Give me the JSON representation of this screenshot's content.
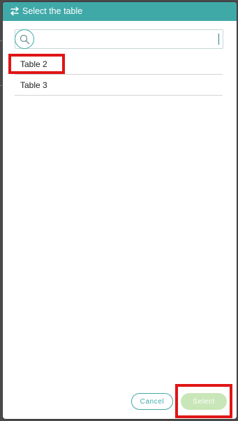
{
  "dialog": {
    "title": "Select the table",
    "header_icon": "swap-arrows-icon",
    "header_color": "#3fa9a8"
  },
  "search": {
    "placeholder": "",
    "value": "",
    "icon": "search-icon"
  },
  "list": {
    "items": [
      {
        "label": "Table 2"
      },
      {
        "label": "Table 3"
      }
    ]
  },
  "footer": {
    "cancel_label": "Cancel",
    "select_label": "Select",
    "select_disabled_color": "#c9e6b8"
  },
  "annotation_color": "#e01616"
}
